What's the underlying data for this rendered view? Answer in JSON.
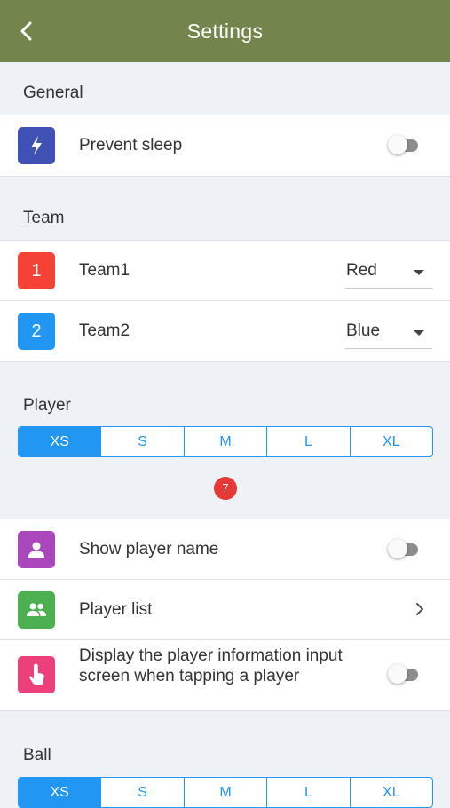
{
  "appbar": {
    "title": "Settings",
    "back_icon": "chevron-left-icon",
    "color": "#74844d"
  },
  "general": {
    "label": "General",
    "prevent_sleep": {
      "label": "Prevent sleep",
      "icon": "bolt-icon",
      "icon_color": "#3f51b5",
      "on": false
    }
  },
  "team": {
    "label": "Team",
    "team1": {
      "badge": "1",
      "label": "Team1",
      "value": "Red",
      "icon_color": "#f44336"
    },
    "team2": {
      "badge": "2",
      "label": "Team2",
      "value": "Blue",
      "icon_color": "#2196f3"
    }
  },
  "player": {
    "label": "Player",
    "sizes": [
      "XS",
      "S",
      "M",
      "L",
      "XL"
    ],
    "selected_size": "XS",
    "preview_number": "7",
    "show_name": {
      "label": "Show player name",
      "icon": "person-icon",
      "icon_color": "#ab47bc",
      "on": false
    },
    "player_list": {
      "label": "Player list",
      "icon": "group-icon",
      "icon_color": "#4caf50"
    },
    "info_screen": {
      "label": "Display the player information input screen when tapping a player",
      "icon": "tap-icon",
      "icon_color": "#ec407a",
      "on": false
    }
  },
  "ball": {
    "label": "Ball",
    "sizes": [
      "XS",
      "S",
      "M",
      "L",
      "XL"
    ],
    "selected_size": "XS"
  },
  "accent_color": "#2196f3"
}
